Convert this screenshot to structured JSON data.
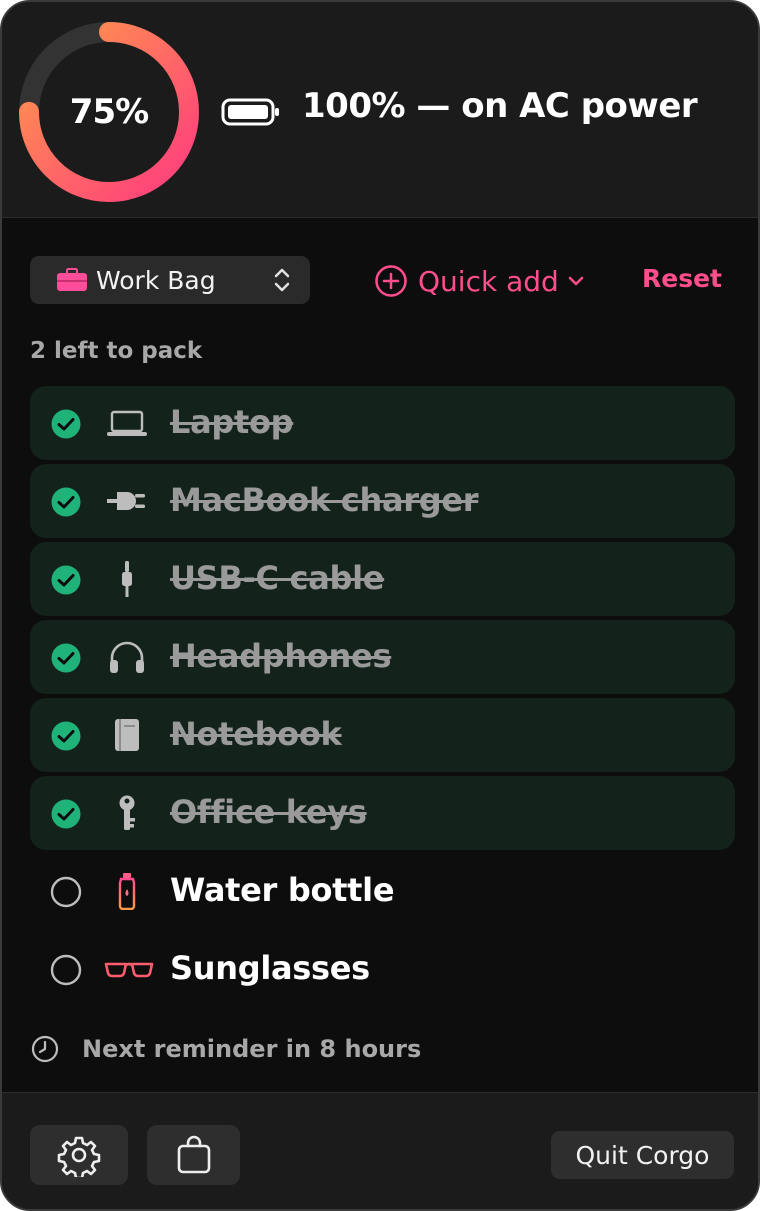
{
  "battery": {
    "ring_percent_label": "75%",
    "ring_fraction": 0.75,
    "status_text": "100% — on AC power",
    "ring_color_start": "#ff3b7f",
    "ring_color_end": "#ff9a4a",
    "ring_track_color": "#333333"
  },
  "controls": {
    "bag_selector": {
      "selected": "Work Bag",
      "icon": "briefcase-icon"
    },
    "quick_add_label": "Quick add",
    "reset_label": "Reset",
    "accent_color": "#ff4d8d"
  },
  "packing": {
    "left_text": "2 left to pack",
    "items": [
      {
        "label": "Laptop",
        "icon": "laptop-icon",
        "checked": true
      },
      {
        "label": "MacBook charger",
        "icon": "plug-icon",
        "checked": true
      },
      {
        "label": "USB-C cable",
        "icon": "cable-icon",
        "checked": true
      },
      {
        "label": "Headphones",
        "icon": "headphones-icon",
        "checked": true
      },
      {
        "label": "Notebook",
        "icon": "book-icon",
        "checked": true
      },
      {
        "label": "Office keys",
        "icon": "key-icon",
        "checked": true
      },
      {
        "label": "Water bottle",
        "icon": "water-bottle-icon",
        "checked": false
      },
      {
        "label": "Sunglasses",
        "icon": "sunglasses-icon",
        "checked": false
      }
    ],
    "check_color": "#1fb37a"
  },
  "reminder": {
    "text": "Next reminder in 8 hours",
    "icon": "clock-icon"
  },
  "footer": {
    "quit_label": "Quit Corgo",
    "settings_icon": "gear-icon",
    "bag_icon": "shopping-bag-icon"
  }
}
